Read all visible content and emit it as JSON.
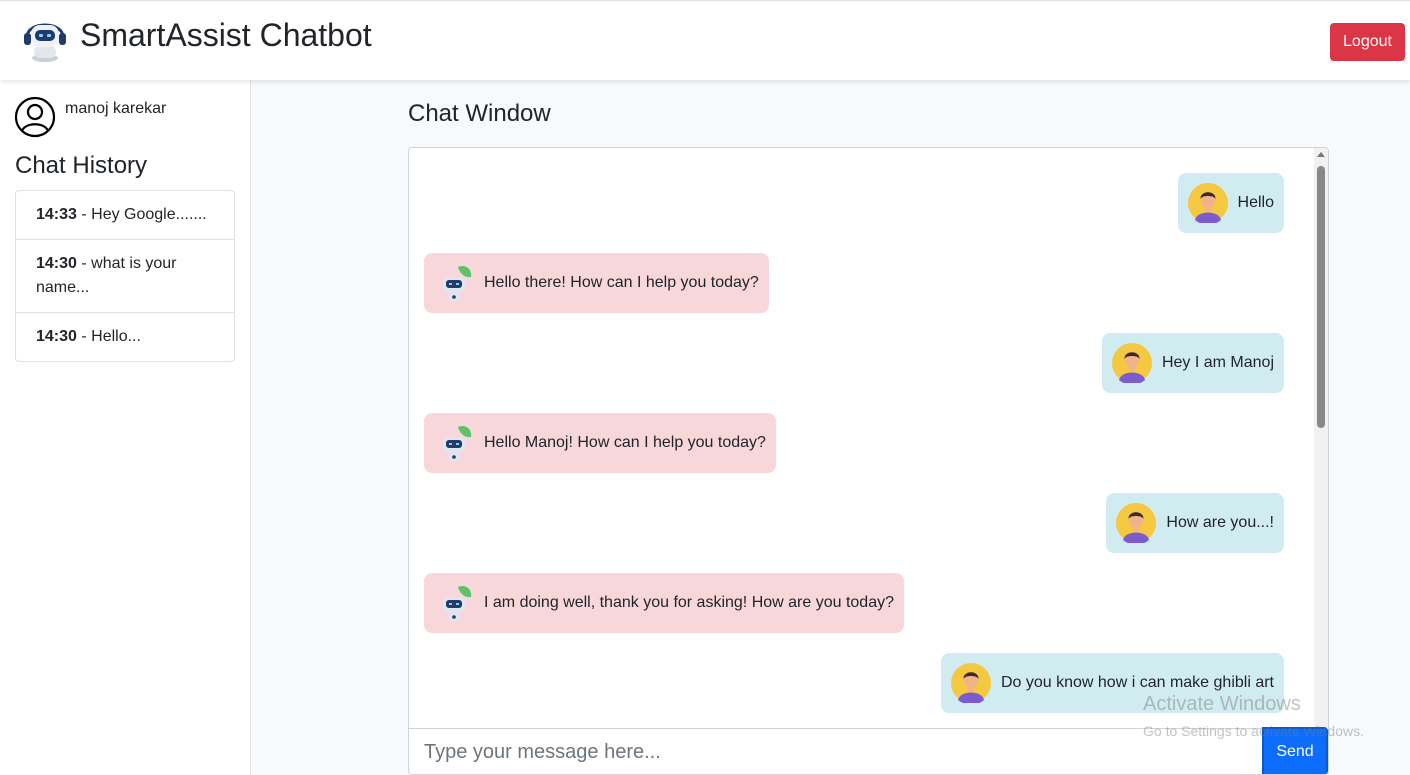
{
  "header": {
    "title": "SmartAssist Chatbot",
    "logout_label": "Logout"
  },
  "sidebar": {
    "user_name": "manoj karekar",
    "history_title": "Chat History",
    "history": [
      {
        "time": "14:33",
        "text": " - Hey Google......."
      },
      {
        "time": "14:30",
        "text": " - what is your name..."
      },
      {
        "time": "14:30",
        "text": " - Hello..."
      }
    ]
  },
  "chat": {
    "title": "Chat Window",
    "messages": [
      {
        "role": "user",
        "text": "Hello"
      },
      {
        "role": "bot",
        "text": "Hello there! How can I help you today?"
      },
      {
        "role": "user",
        "text": "Hey I am Manoj"
      },
      {
        "role": "bot",
        "text": "Hello Manoj! How can I help you today?"
      },
      {
        "role": "user",
        "text": "How are you...!"
      },
      {
        "role": "bot",
        "text": "I am doing well, thank you for asking! How are you today?"
      },
      {
        "role": "user",
        "text": "Do you know how i can make ghibli art"
      }
    ],
    "input_placeholder": "Type your message here...",
    "send_label": "Send"
  },
  "watermark": {
    "title": "Activate Windows",
    "subtitle": "Go to Settings to activate Windows."
  },
  "colors": {
    "logout": "#dc3545",
    "send": "#0d6efd",
    "user_bubble": "#d1ecf1",
    "bot_bubble": "#f8d7da"
  },
  "icons": {
    "logo": "robot-headset-icon",
    "user": "user-circle-icon",
    "user_avatar": "man-avatar-icon",
    "bot_avatar": "robot-avatar-icon"
  }
}
